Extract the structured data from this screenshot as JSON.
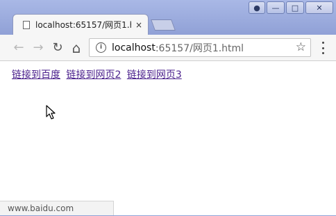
{
  "tab": {
    "title": "localhost:65157/网页1.h",
    "close": "×"
  },
  "address": {
    "host": "localhost",
    "rest": ":65157/网页1.html"
  },
  "icons": {
    "back": "←",
    "forward": "→",
    "reload": "↻",
    "home": "⌂",
    "info": "i",
    "star": "☆",
    "user": "●",
    "minimize": "—",
    "maximize": "□",
    "close": "✕"
  },
  "links": [
    "链接到百度",
    "链接到网页2",
    "链接到网页3"
  ],
  "status_url": "www.baidu.com"
}
